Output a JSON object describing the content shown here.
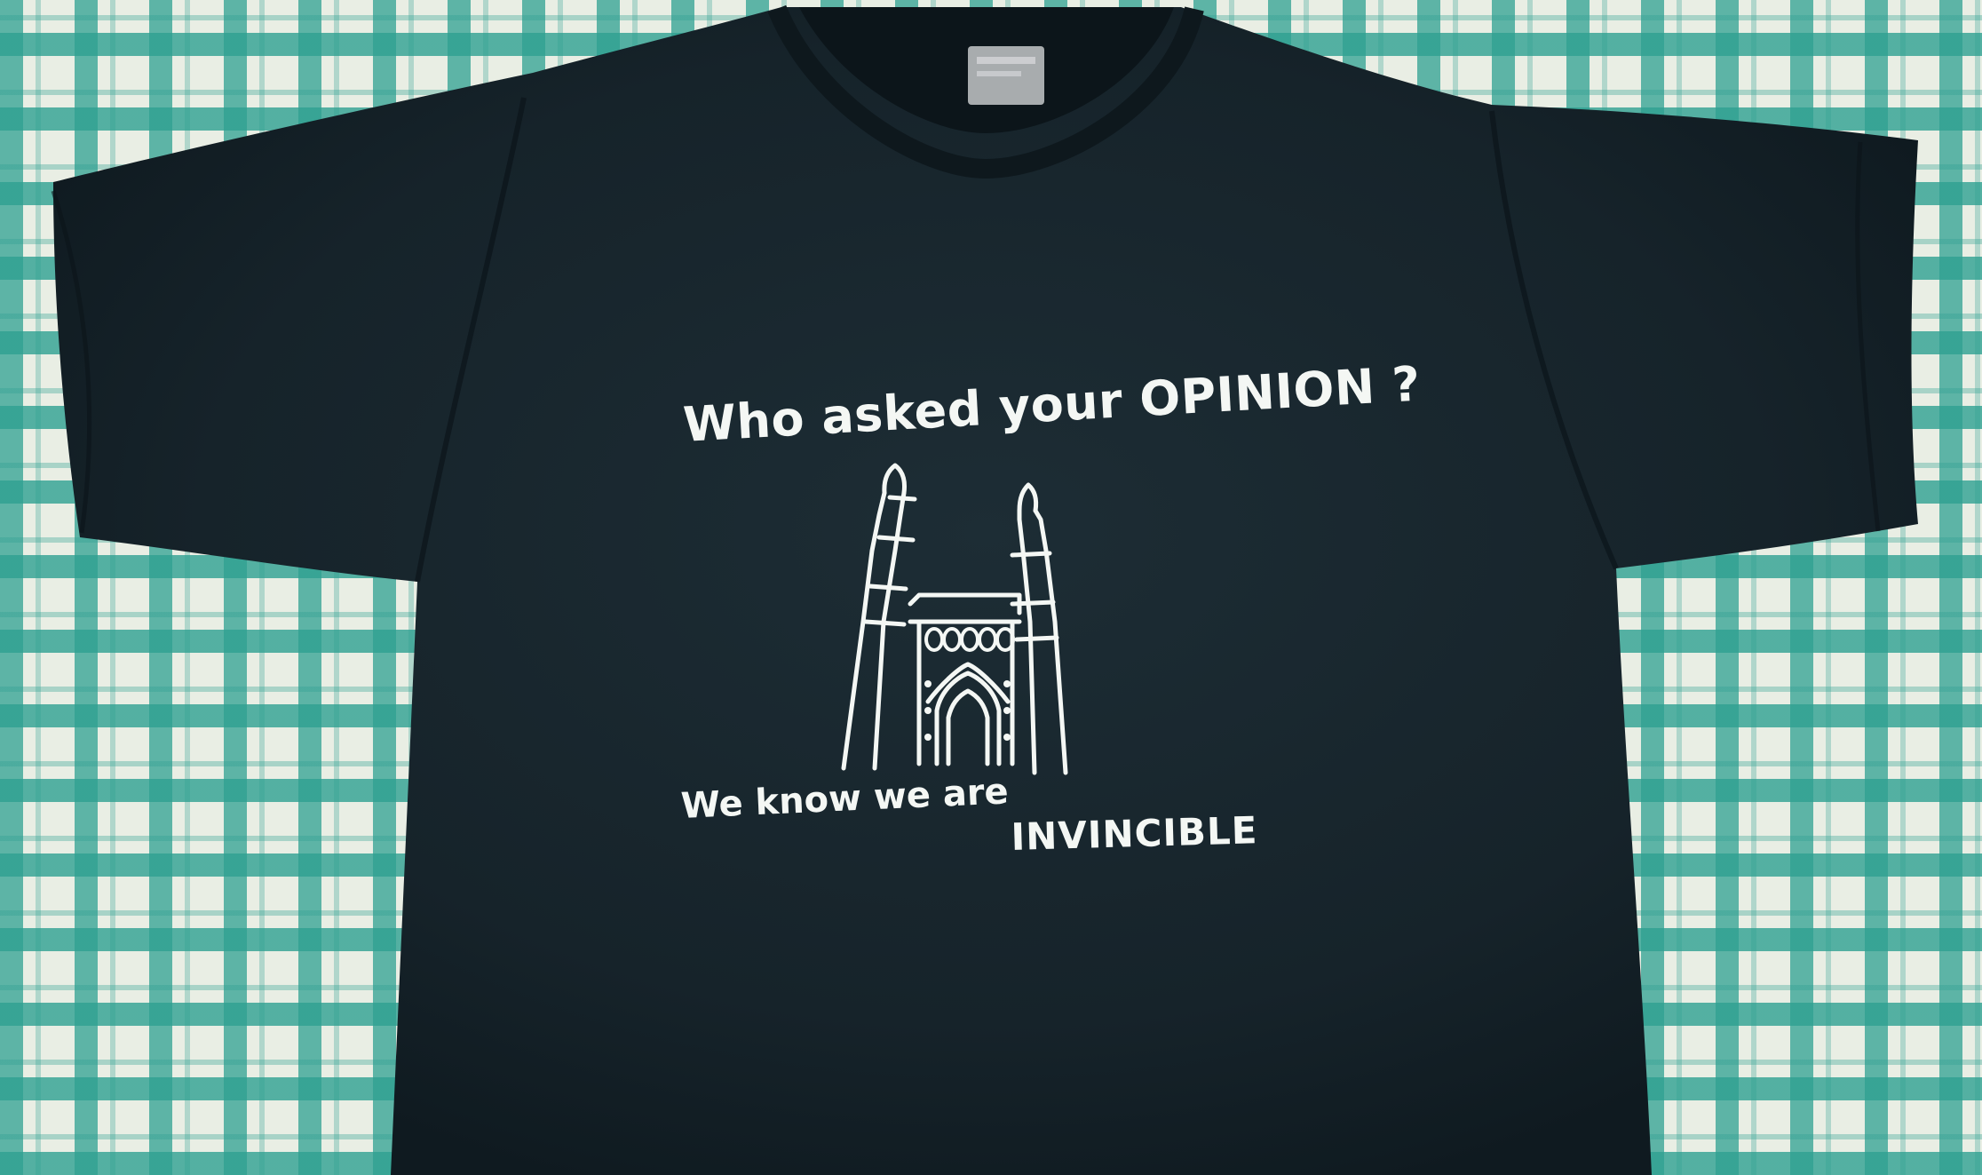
{
  "colors": {
    "shirt": "#16232a",
    "print": "#f4f7f4",
    "fabric_check": "#2ea091",
    "fabric_base": "#e9eee4",
    "neck_label": "#b9bcbf"
  },
  "print": {
    "headline": "Who asked your OPINION ?",
    "tagline": "We know we are",
    "emphasis": "INVINCIBLE"
  },
  "icons": {
    "monument": "charminar-icon"
  }
}
